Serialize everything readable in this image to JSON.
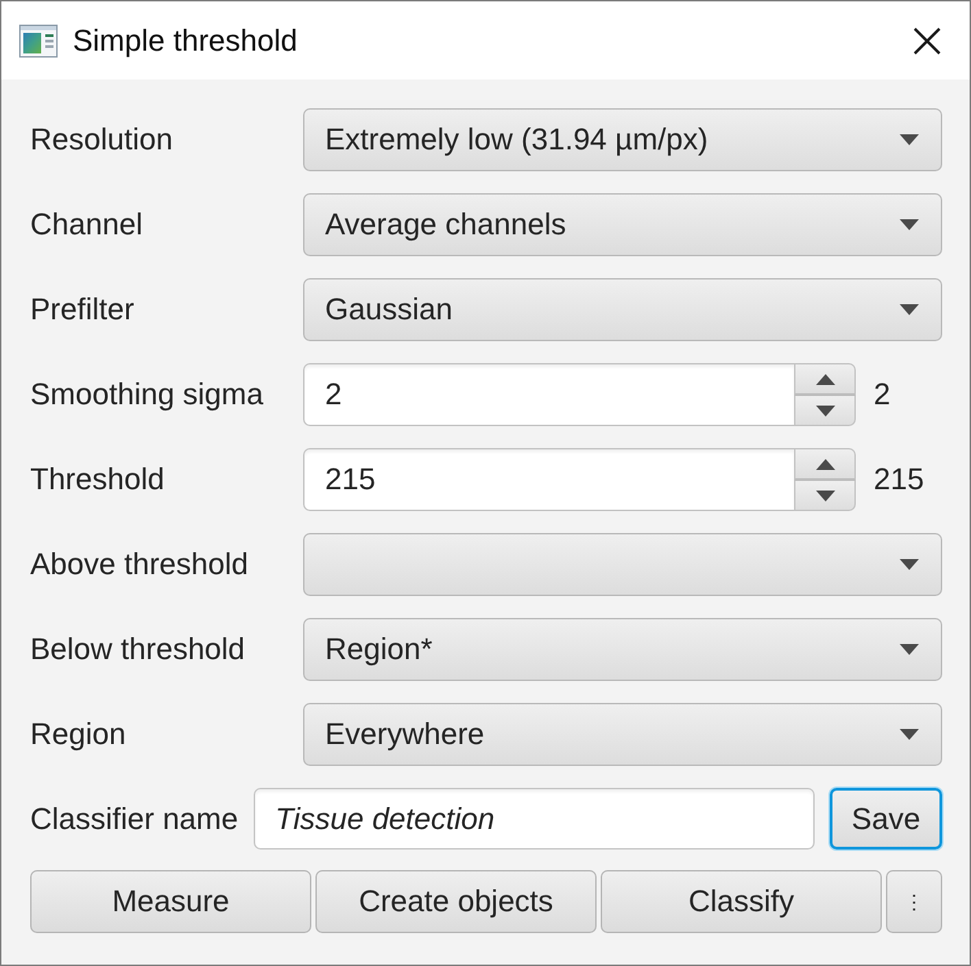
{
  "window": {
    "title": "Simple threshold"
  },
  "rows": [
    {
      "kind": "combo",
      "label": "Resolution",
      "value": "Extremely low (31.94 µm/px)"
    },
    {
      "kind": "combo",
      "label": "Channel",
      "value": "Average channels"
    },
    {
      "kind": "combo",
      "label": "Prefilter",
      "value": "Gaussian"
    },
    {
      "kind": "spinner",
      "label": "Smoothing sigma",
      "value": "2",
      "reading": "2"
    },
    {
      "kind": "spinner",
      "label": "Threshold",
      "value": "215",
      "reading": "215"
    },
    {
      "kind": "combo",
      "label": "Above threshold"
    },
    {
      "kind": "combo",
      "label": "Below threshold",
      "value": "Region*"
    },
    {
      "kind": "combo",
      "label": "Region",
      "value": "Everywhere"
    }
  ],
  "name_row": {
    "label": "Classifier name",
    "value": "Tissue detection",
    "button": {
      "label": "Save",
      "focused": true
    }
  },
  "actions": [
    {
      "label": "Measure"
    },
    {
      "label": "Create objects"
    },
    {
      "label": "Classify"
    },
    {
      "label": "⋮"
    }
  ]
}
